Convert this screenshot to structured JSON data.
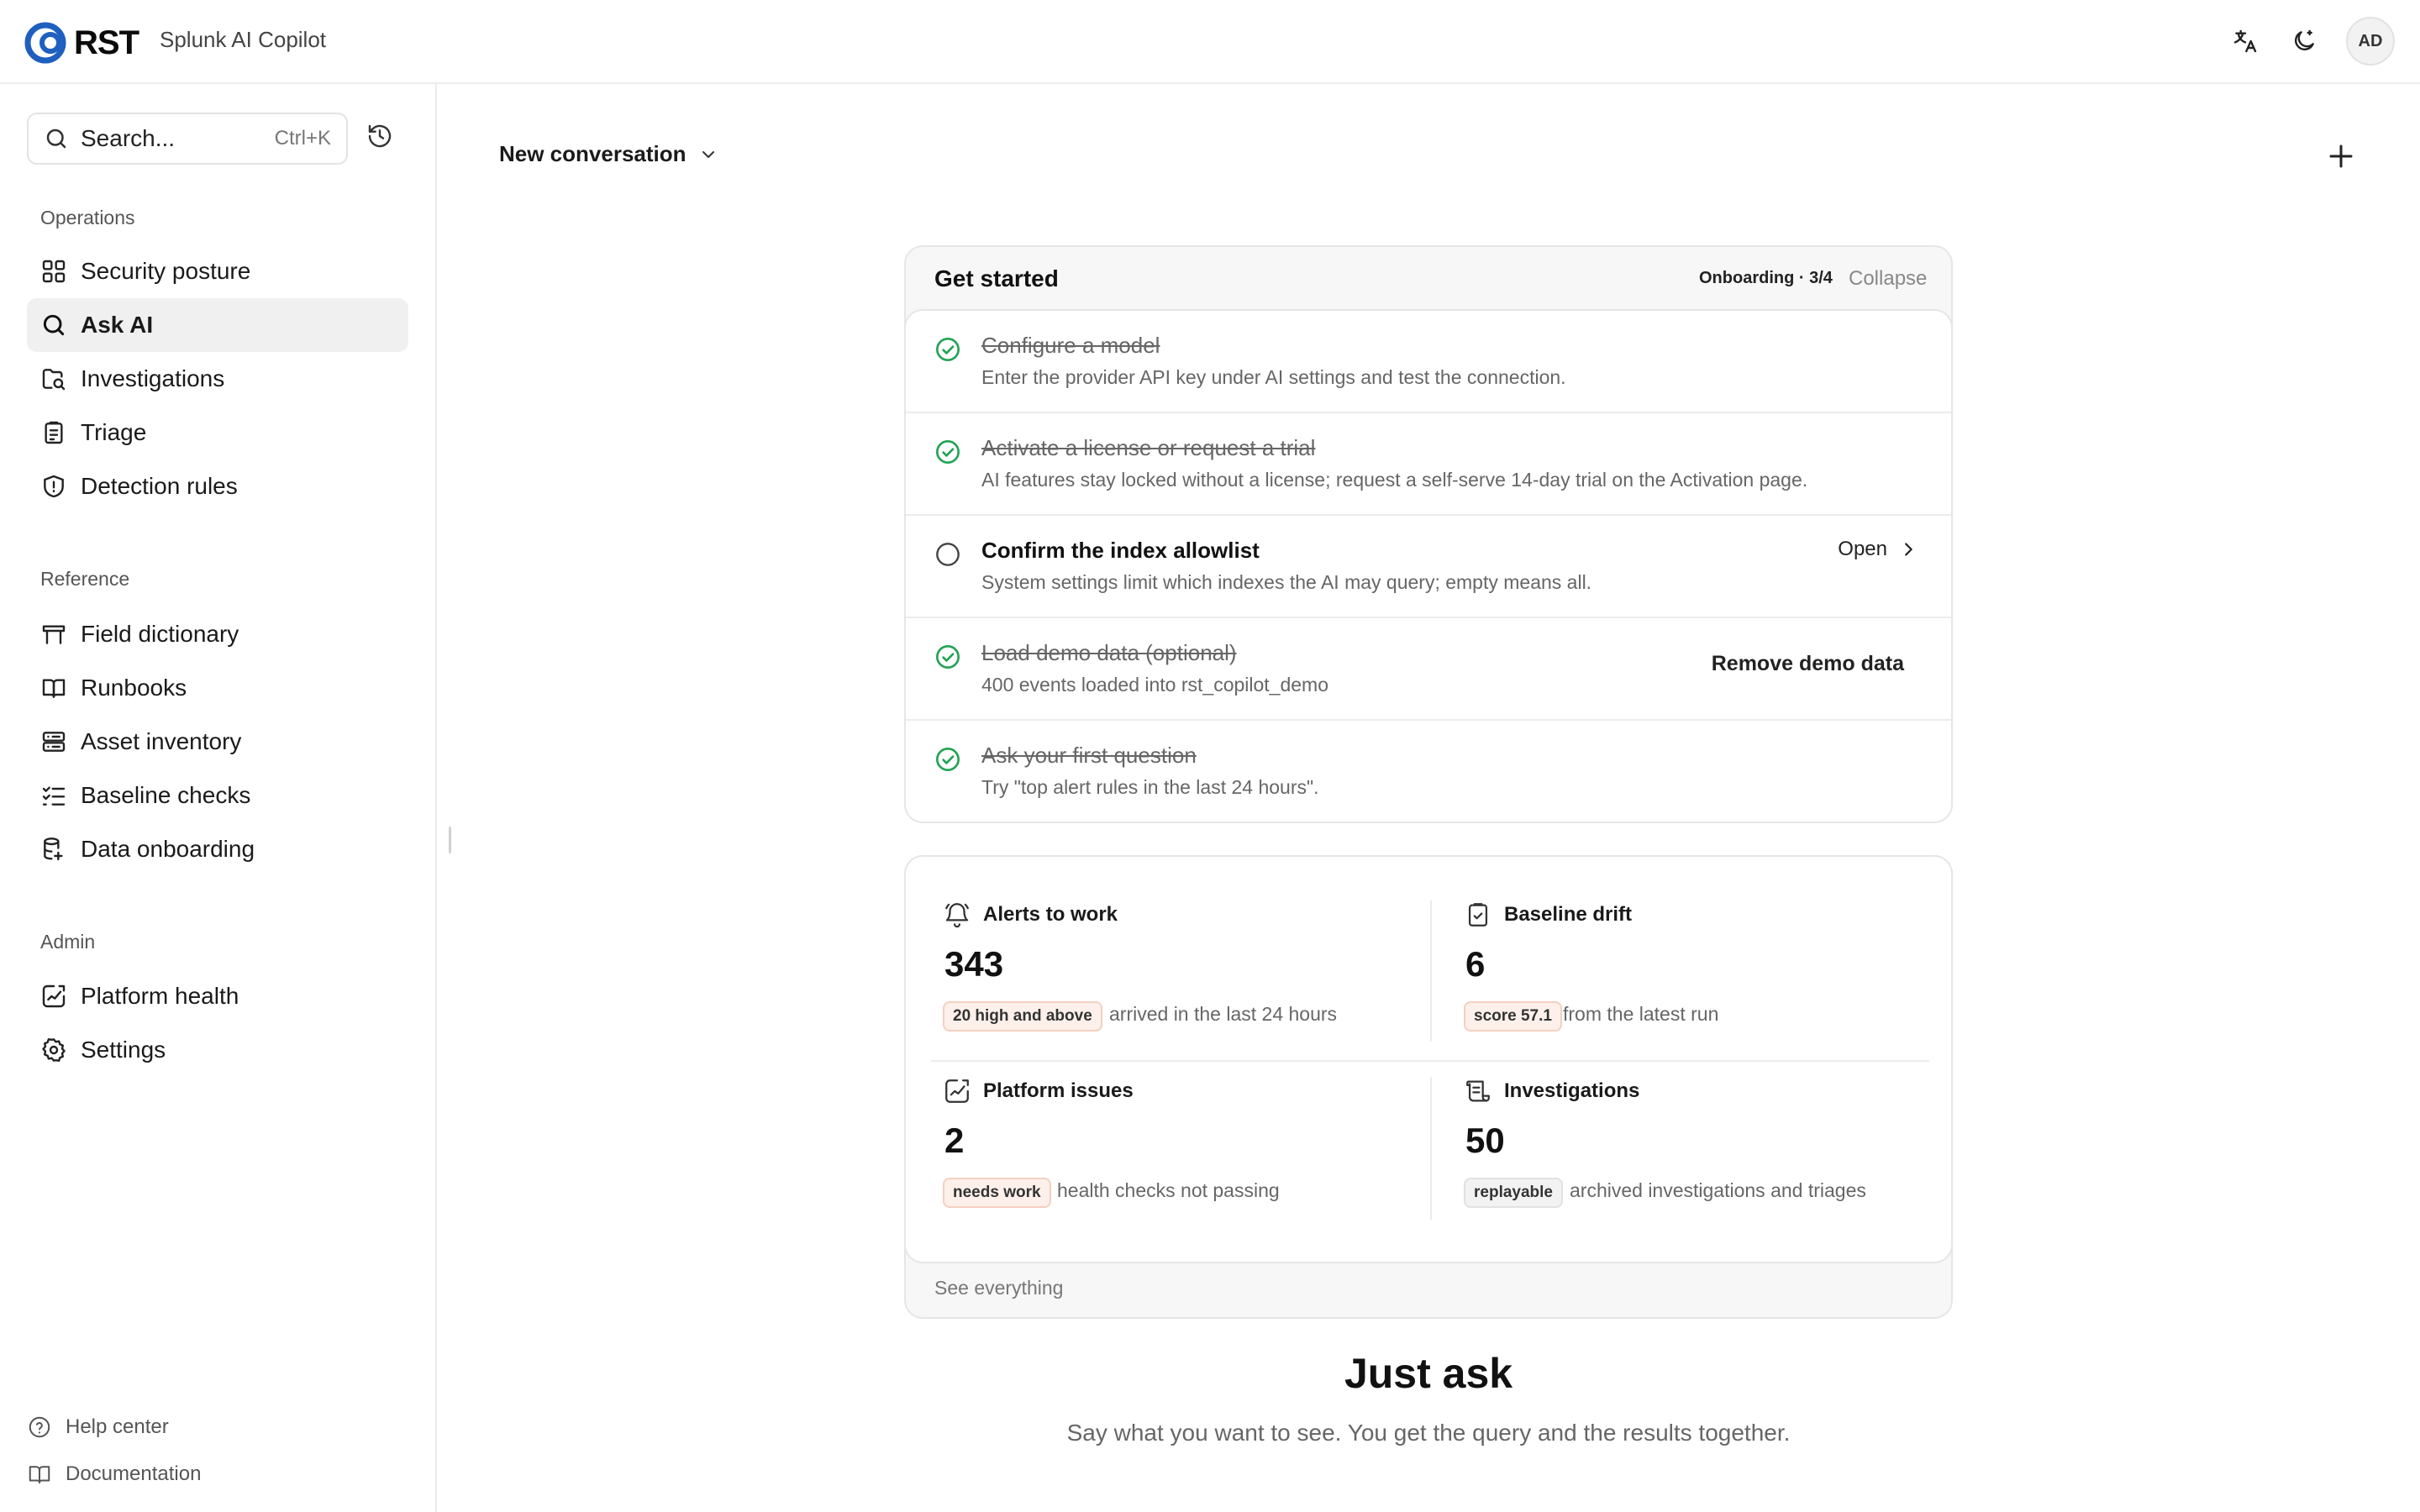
{
  "header": {
    "logo_text": "RST",
    "product_name": "Splunk AI Copilot",
    "avatar_initials": "AD",
    "icons": [
      "translate-icon",
      "moon-icon"
    ]
  },
  "sidebar": {
    "search": {
      "placeholder": "Search...",
      "shortcut": "Ctrl+K"
    },
    "sections": [
      {
        "label": "Operations",
        "items": [
          {
            "label": "Security posture",
            "icon": "grid-icon"
          },
          {
            "label": "Ask AI",
            "icon": "search-icon",
            "active": true
          },
          {
            "label": "Investigations",
            "icon": "folder-search-icon"
          },
          {
            "label": "Triage",
            "icon": "clipboard-icon"
          },
          {
            "label": "Detection rules",
            "icon": "shield-icon"
          }
        ]
      },
      {
        "label": "Reference",
        "items": [
          {
            "label": "Field dictionary",
            "icon": "table-icon"
          },
          {
            "label": "Runbooks",
            "icon": "book-icon"
          },
          {
            "label": "Asset inventory",
            "icon": "server-icon"
          },
          {
            "label": "Baseline checks",
            "icon": "checklist-icon"
          },
          {
            "label": "Data onboarding",
            "icon": "database-icon"
          }
        ]
      },
      {
        "label": "Admin",
        "items": [
          {
            "label": "Platform health",
            "icon": "chart-icon"
          },
          {
            "label": "Settings",
            "icon": "gear-icon"
          }
        ]
      }
    ],
    "footer": {
      "help": "Help center",
      "docs": "Documentation"
    }
  },
  "main": {
    "conversation_title": "New conversation",
    "get_started": {
      "title": "Get started",
      "badge": "Onboarding · 3/4",
      "collapse": "Collapse",
      "steps": [
        {
          "title": "Configure a model",
          "desc": "Enter the provider API key under AI settings and test the connection.",
          "done": true,
          "action": ""
        },
        {
          "title": "Activate a license or request a trial",
          "desc": "AI features stay locked without a license; request a self-serve 14-day trial on the Activation page.",
          "done": true,
          "action": ""
        },
        {
          "title": "Confirm the index allowlist",
          "desc": "System settings limit which indexes the AI may query; empty means all.",
          "done": false,
          "action": "Open"
        },
        {
          "title": "Load demo data (optional)",
          "desc": "400 events loaded into rst_copilot_demo",
          "done": true,
          "action": "Remove demo data"
        },
        {
          "title": "Ask your first question",
          "desc": "Try \"top alert rules in the last 24 hours\".",
          "done": true,
          "action": ""
        }
      ]
    },
    "metrics": [
      {
        "label": "Alerts to work",
        "value": "343",
        "tag": "20 high and above",
        "tag_style": "warn",
        "desc": "arrived in the last 24 hours",
        "icon": "bell-icon"
      },
      {
        "label": "Baseline drift",
        "value": "6",
        "tag": "score 57.1",
        "tag_style": "warn",
        "desc": "from the latest run",
        "icon": "clipboard-check-icon"
      },
      {
        "label": "Platform issues",
        "value": "2",
        "tag": "needs work",
        "tag_style": "warn",
        "desc": "health checks not passing",
        "icon": "chart-icon"
      },
      {
        "label": "Investigations",
        "value": "50",
        "tag": "replayable",
        "tag_style": "neutral",
        "desc": "archived investigations and triages",
        "icon": "scroll-icon"
      }
    ],
    "metrics_footer": "See everything",
    "hero": {
      "title": "Just ask",
      "subtitle": "Say what you want to see. You get the query and the results together."
    }
  },
  "colors": {
    "accent_blue": "#1f5fbf",
    "check_green": "#22a355",
    "active_nav_bg": "#f0f0f0"
  }
}
